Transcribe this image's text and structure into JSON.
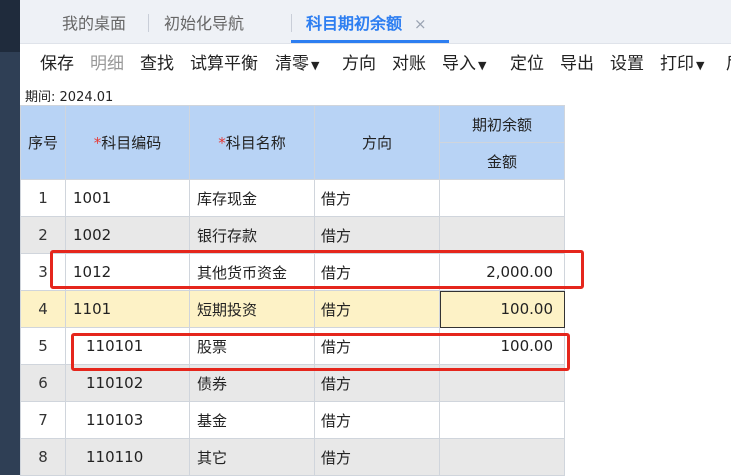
{
  "tabs": [
    {
      "label": "我的桌面"
    },
    {
      "label": "初始化导航"
    },
    {
      "label": "科目期初余额",
      "close": "×"
    }
  ],
  "toolbar": {
    "save": "保存",
    "detail": "明细",
    "find": "查找",
    "trial_balance": "试算平衡",
    "clear": "清零",
    "direction": "方向",
    "reconcile": "对账",
    "import": "导入",
    "locate": "定位",
    "export": "导出",
    "settings": "设置",
    "print": "打印",
    "more": "后"
  },
  "period": {
    "label": "期间:",
    "value": "2024.01"
  },
  "grid": {
    "headers": {
      "idx": "序号",
      "code": "科目编码",
      "name": "科目名称",
      "direction": "方向",
      "opening": "期初余额",
      "amount": "金额"
    },
    "required_mark": "*",
    "rows": [
      {
        "idx": "1",
        "code": "1001",
        "name": "库存现金",
        "direction": "借方",
        "amount": ""
      },
      {
        "idx": "2",
        "code": "1002",
        "name": "银行存款",
        "direction": "借方",
        "amount": ""
      },
      {
        "idx": "3",
        "code": "1012",
        "name": "其他货币资金",
        "direction": "借方",
        "amount": "2,000.00"
      },
      {
        "idx": "4",
        "code": "1101",
        "name": "短期投资",
        "direction": "借方",
        "amount": "100.00"
      },
      {
        "idx": "5",
        "code": "110101",
        "name": "股票",
        "direction": "借方",
        "amount": "100.00"
      },
      {
        "idx": "6",
        "code": "110102",
        "name": "债券",
        "direction": "借方",
        "amount": ""
      },
      {
        "idx": "7",
        "code": "110103",
        "name": "基金",
        "direction": "借方",
        "amount": ""
      },
      {
        "idx": "8",
        "code": "110110",
        "name": "其它",
        "direction": "借方",
        "amount": ""
      }
    ]
  },
  "colors": {
    "accent": "#2d7ef1",
    "header_bg": "#b8d3f5",
    "highlight_row": "#fdf2c6",
    "annotation": "#e5261c"
  }
}
